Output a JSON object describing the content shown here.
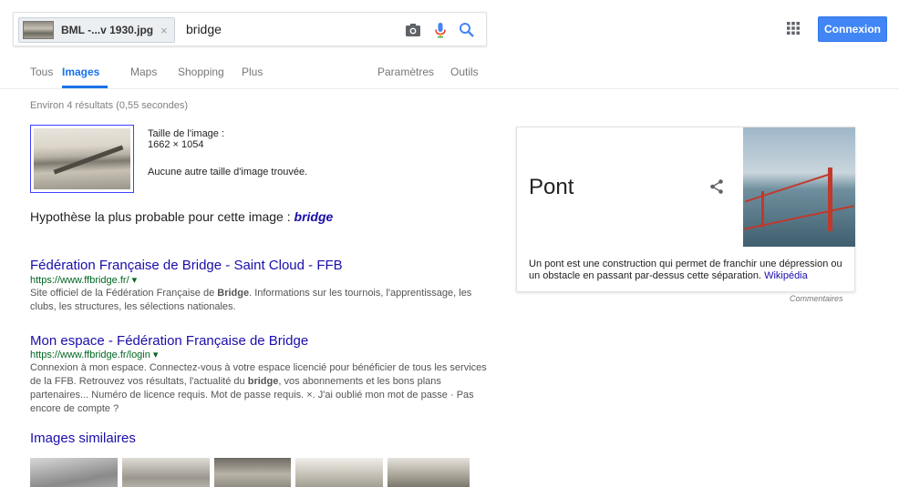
{
  "search": {
    "chip_label": "BML -...v 1930.jpg",
    "chip_close": "×",
    "query": "bridge"
  },
  "header": {
    "signin_label": "Connexion"
  },
  "tabs": [
    {
      "label": "Tous"
    },
    {
      "label": "Images"
    },
    {
      "label": "Maps"
    },
    {
      "label": "Shopping"
    },
    {
      "label": "Plus"
    }
  ],
  "tools": {
    "settings_label": "Paramètres",
    "tools_label": "Outils"
  },
  "stats": "Environ 4 résultats (0,55 secondes)",
  "image_info": {
    "size_label": "Taille de l'image :",
    "size_value": "1662 × 1054",
    "no_other": "Aucune autre taille d'image trouvée."
  },
  "guess": {
    "prefix": "Hypothèse la plus probable pour cette image :",
    "term": "bridge"
  },
  "results": [
    {
      "title": "Fédération Française de Bridge - Saint Cloud - FFB",
      "url": "https://www.ffbridge.fr/ ▾",
      "snippet_1": "Site officiel de la Fédération Française de ",
      "snippet_bold": "Bridge",
      "snippet_2": ". Informations sur les tournois, l'apprentissage, les clubs, les structures, les sélections nationales."
    },
    {
      "title": "Mon espace - Fédération Française de Bridge",
      "url": "https://www.ffbridge.fr/login ▾",
      "snippet_1": "Connexion à mon espace. Connectez-vous à votre espace licencié pour bénéficier de tous les services de la FFB. Retrouvez vos résultats, l'actualité du ",
      "snippet_bold": "bridge",
      "snippet_2": ", vos abonnements et les bons plans partenaires... Numéro de licence requis. Mot de passe requis. ×. J'ai oublié mon mot de passe · Pas encore de compte ?"
    }
  ],
  "similar": {
    "title": "Images similaires"
  },
  "knowledge_panel": {
    "title": "Pont",
    "description": "Un pont est une construction qui permet de franchir une dépression ou un obstacle en passant par-dessus cette séparation. ",
    "source": "Wikipédia",
    "feedback": "Commentaires"
  }
}
